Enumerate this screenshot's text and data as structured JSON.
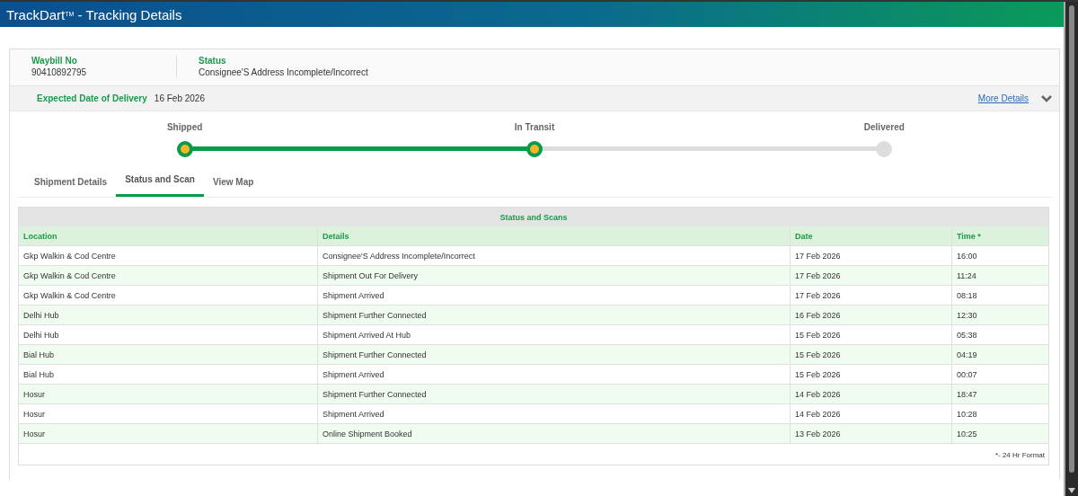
{
  "window": {
    "title": "TrackDart$^{TM}$ - Tracking Details"
  },
  "summary": {
    "waybill_label": "Waybill No",
    "waybill": "90410892795",
    "status_label": "Status",
    "status": "Consignee'S Address Incomplete/Incorrect"
  },
  "delivery": {
    "label": "Expected Date of Delivery",
    "date": "16 Feb 2026",
    "link": "More Details",
    "expanded": false
  },
  "steps": [
    {
      "label": "Shipped",
      "reached": true
    },
    {
      "label": "In Transit",
      "reached": true
    },
    {
      "label": "Delivered",
      "reached": false
    }
  ],
  "tabs": [
    {
      "label": "Shipment Details",
      "selected": false
    },
    {
      "label": "Status and Scan",
      "selected": true
    },
    {
      "label": "View Map",
      "selected": false
    }
  ],
  "table": {
    "title": "Status and Scans",
    "columns": [
      "Location",
      "Details",
      "Date",
      "Time *"
    ],
    "rows": [
      [
        "Gkp Walkin & Cod Centre",
        "Consignee'S Address Incomplete/Incorrect",
        "17 Feb 2026",
        "16:00"
      ],
      [
        "Gkp Walkin & Cod Centre",
        "Shipment Out For Delivery",
        "17 Feb 2026",
        "11:24"
      ],
      [
        "Gkp Walkin & Cod Centre",
        "Shipment Arrived",
        "17 Feb 2026",
        "08:18"
      ],
      [
        "Delhi Hub",
        "Shipment Further Connected",
        "16 Feb 2026",
        "12:30"
      ],
      [
        "Delhi Hub",
        "Shipment Arrived At Hub",
        "15 Feb 2026",
        "05:38"
      ],
      [
        "Bial Hub",
        "Shipment Further Connected",
        "15 Feb 2026",
        "04:19"
      ],
      [
        "Bial Hub",
        "Shipment Arrived",
        "15 Feb 2026",
        "00:07"
      ],
      [
        "Hosur",
        "Shipment Further Connected",
        "14 Feb 2026",
        "18:47"
      ],
      [
        "Hosur",
        "Shipment Arrived",
        "14 Feb 2026",
        "10:28"
      ],
      [
        "Hosur",
        "Online Shipment Booked",
        "13 Feb 2026",
        "10:25"
      ]
    ],
    "footnote": "*- 24 Hr Format"
  }
}
